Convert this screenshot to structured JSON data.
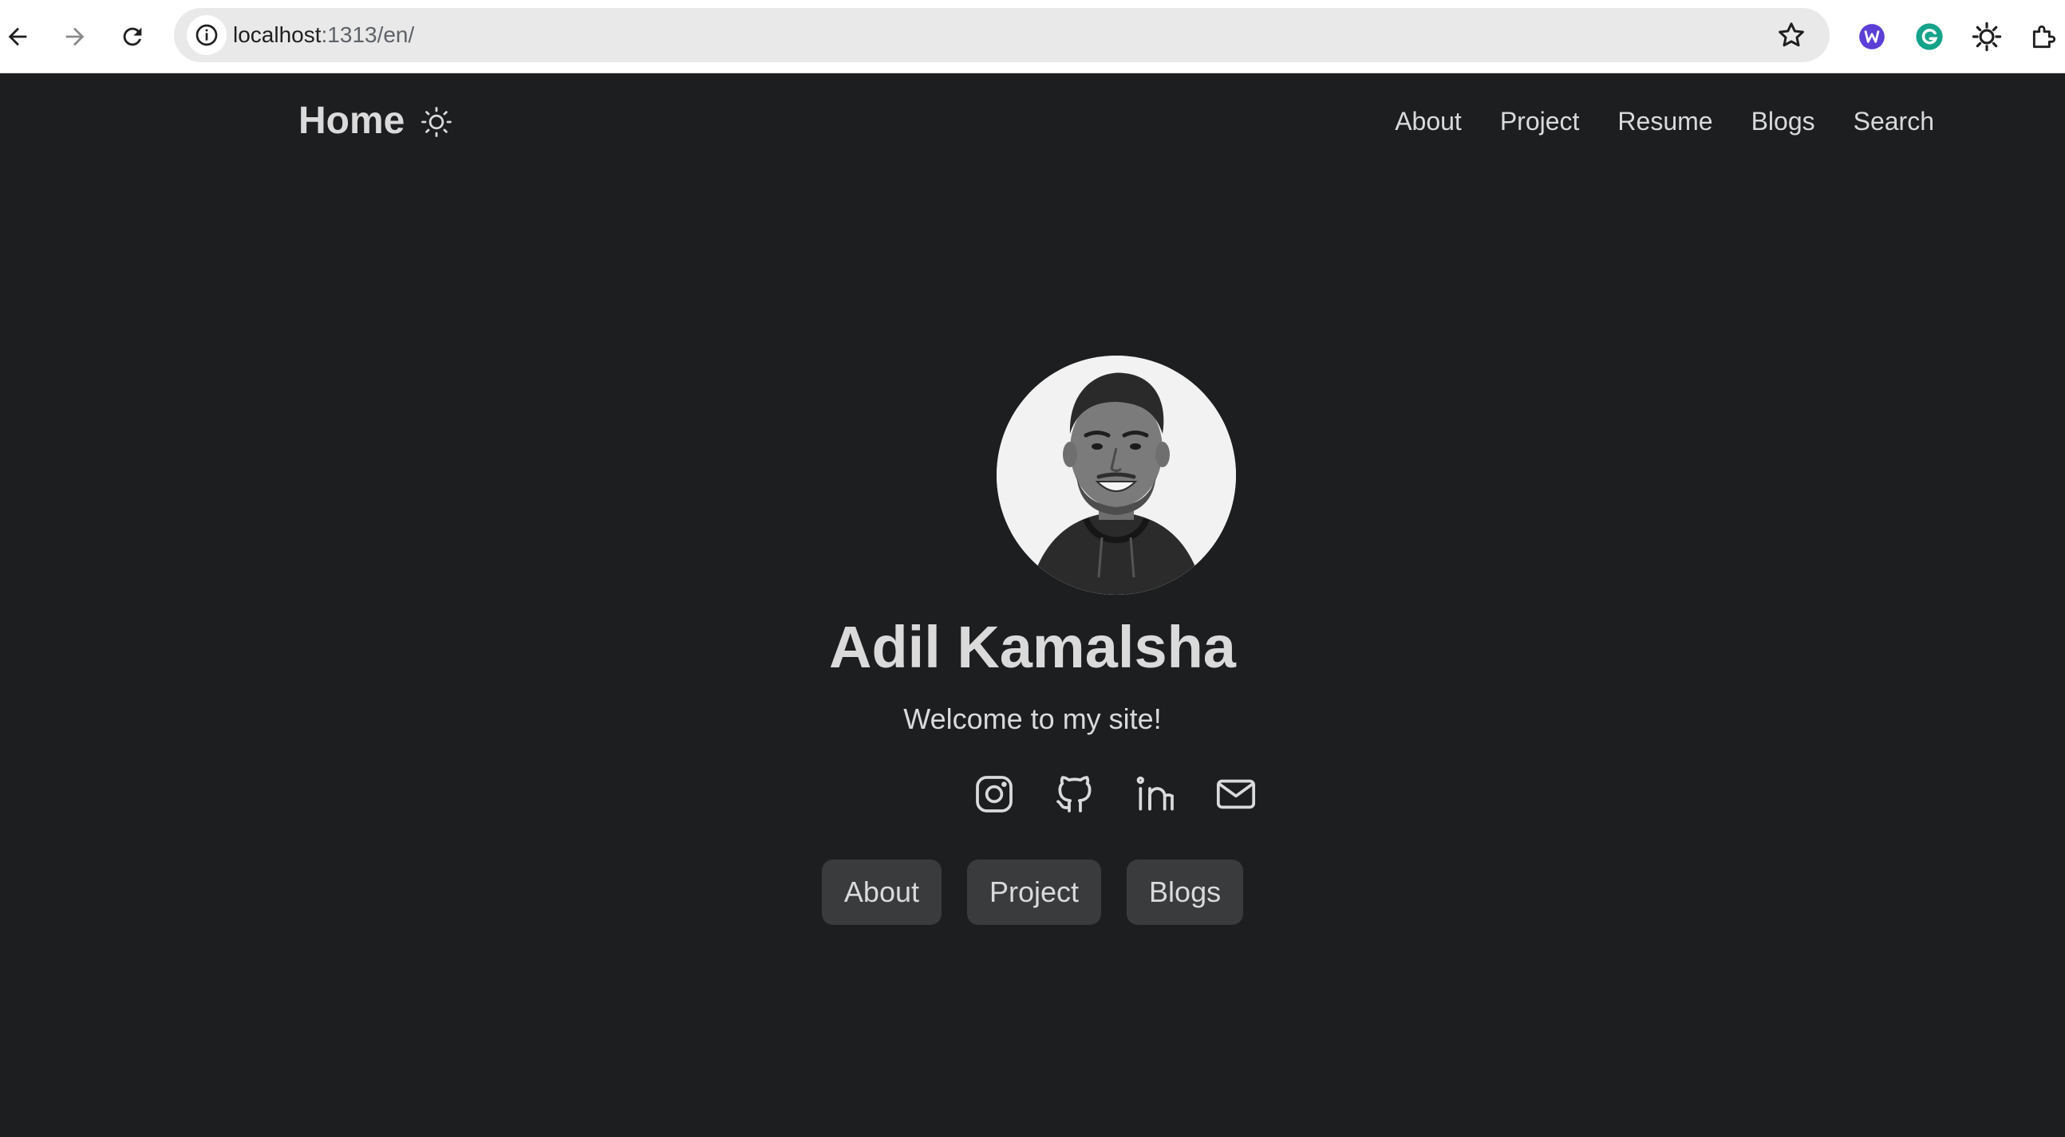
{
  "browser": {
    "url_host": "localhost",
    "url_rest": ":1313/en/",
    "icons": [
      "back-arrow-icon",
      "forward-arrow-icon",
      "reload-icon",
      "site-info-icon",
      "bookmark-star-icon",
      "extension-w-icon",
      "grammarly-icon",
      "sun-extension-icon",
      "puzzle-icon"
    ]
  },
  "header": {
    "logo": "Home",
    "theme_toggle_icon": "sun-icon",
    "menu": [
      {
        "label": "About"
      },
      {
        "label": "Project"
      },
      {
        "label": "Resume"
      },
      {
        "label": "Blogs"
      },
      {
        "label": "Search"
      }
    ]
  },
  "profile": {
    "name": "Adil Kamalsha",
    "subtitle": "Welcome to my site!",
    "socials": [
      "instagram-icon",
      "github-icon",
      "linkedin-icon",
      "email-icon"
    ],
    "buttons": [
      {
        "label": "About"
      },
      {
        "label": "Project"
      },
      {
        "label": "Blogs"
      }
    ]
  },
  "colors": {
    "background": "#1d1e20",
    "text": "#dadadb",
    "button_bg": "#3a3b3d",
    "chrome_bg": "#ffffff",
    "omnibox_bg": "#e9e9e9"
  }
}
